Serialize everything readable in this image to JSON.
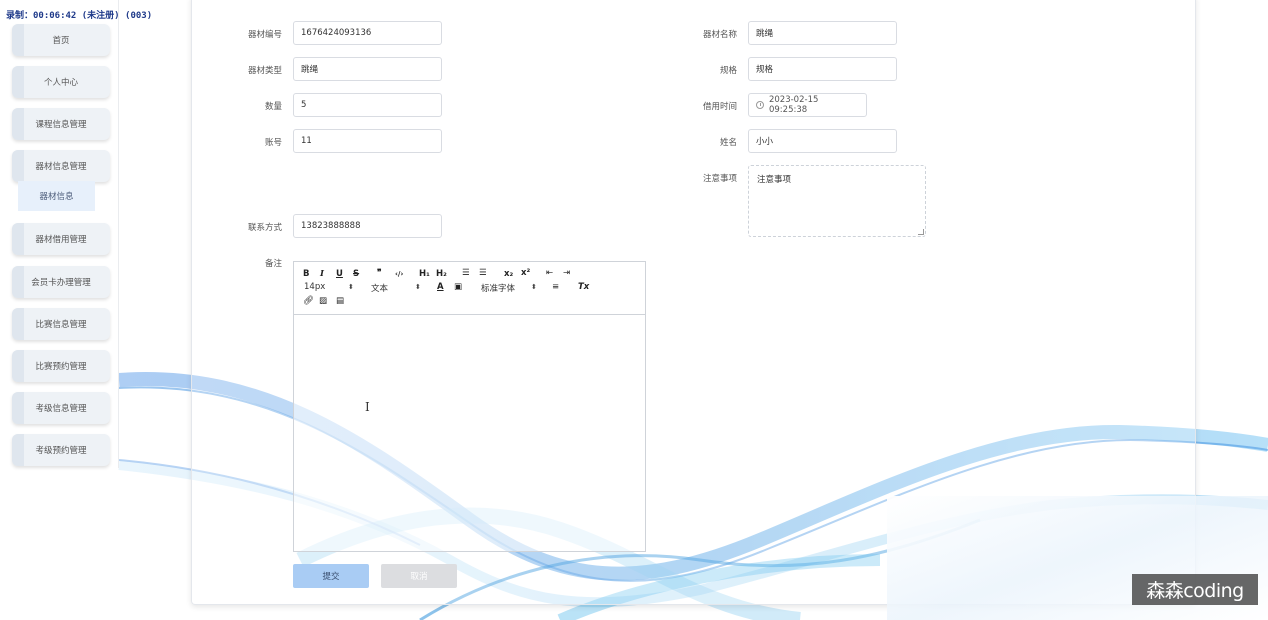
{
  "overlay": {
    "recording_text": "录制：00:06:42 (未注册) (003)"
  },
  "sidebar": {
    "items": [
      {
        "label": "首页"
      },
      {
        "label": "个人中心"
      },
      {
        "label": "课程信息管理"
      },
      {
        "label": "器材信息管理"
      },
      {
        "label": "器材借用管理"
      },
      {
        "label": "会员卡办理管理"
      },
      {
        "label": "比赛信息管理"
      },
      {
        "label": "比赛预约管理"
      },
      {
        "label": "考级信息管理"
      },
      {
        "label": "考级预约管理"
      }
    ],
    "submenu": {
      "label": "器材信息"
    }
  },
  "form": {
    "equip_no": {
      "label": "器材编号",
      "value": "1676424093136"
    },
    "equip_name": {
      "label": "器材名称",
      "value": "跳绳"
    },
    "equip_type": {
      "label": "器材类型",
      "value": "跳绳"
    },
    "spec": {
      "label": "规格",
      "value": "规格"
    },
    "quantity": {
      "label": "数量",
      "value": "5"
    },
    "borrow_time": {
      "label": "借用时间",
      "value": "2023-02-15 09:25:38"
    },
    "account": {
      "label": "账号",
      "value": "11"
    },
    "name": {
      "label": "姓名",
      "value": "小小"
    },
    "notes": {
      "label": "注意事项",
      "value": "注意事项"
    },
    "contact": {
      "label": "联系方式",
      "value": "13823888888"
    },
    "remark": {
      "label": "备注"
    }
  },
  "editor": {
    "font_size": "14px",
    "text_style": "文本",
    "font_family": "标准字体"
  },
  "buttons": {
    "submit": "提交",
    "cancel": "取消"
  },
  "watermark": "森森coding"
}
